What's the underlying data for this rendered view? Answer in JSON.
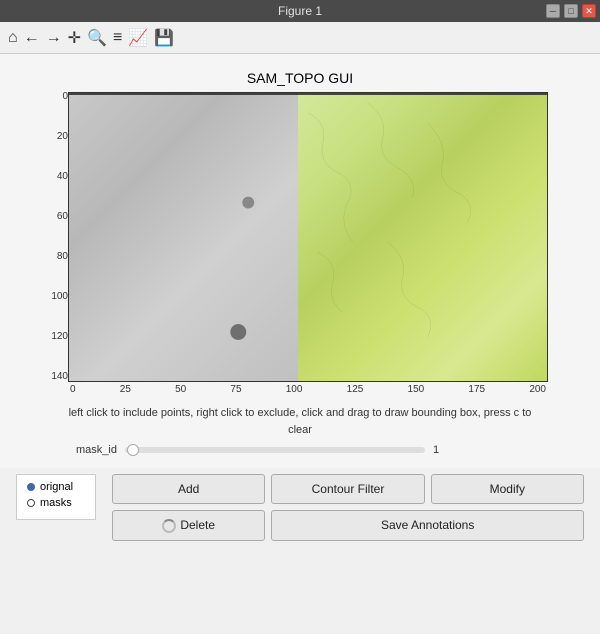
{
  "window": {
    "title": "Figure 1"
  },
  "toolbar_icons": [
    "home",
    "back",
    "forward",
    "move",
    "zoom",
    "configure",
    "chart",
    "save"
  ],
  "page_title": "SAM_TOPO GUI",
  "chart": {
    "y_labels": [
      "0",
      "20",
      "40",
      "60",
      "80",
      "100",
      "120",
      "140"
    ],
    "x_labels": [
      "0",
      "25",
      "50",
      "75",
      "100",
      "125",
      "150",
      "175",
      "200"
    ]
  },
  "instructions": "left click to include points, right click to exclude, click and drag to draw bounding box,\npress c to clear",
  "mask": {
    "label": "mask_id",
    "value": "1",
    "slider_position": 0
  },
  "legend": {
    "items": [
      {
        "label": "orignal",
        "type": "filled"
      },
      {
        "label": "masks",
        "type": "empty"
      }
    ]
  },
  "buttons": [
    {
      "label": "Add",
      "name": "add-button",
      "disabled": false
    },
    {
      "label": "Contour Filter",
      "name": "contour-filter-button",
      "disabled": false
    },
    {
      "label": "Modify",
      "name": "modify-button",
      "disabled": false
    },
    {
      "label": "Delete",
      "name": "delete-button",
      "disabled": false,
      "loading": true
    },
    {
      "label": "Save Annotations",
      "name": "save-annotations-button",
      "disabled": false
    }
  ]
}
